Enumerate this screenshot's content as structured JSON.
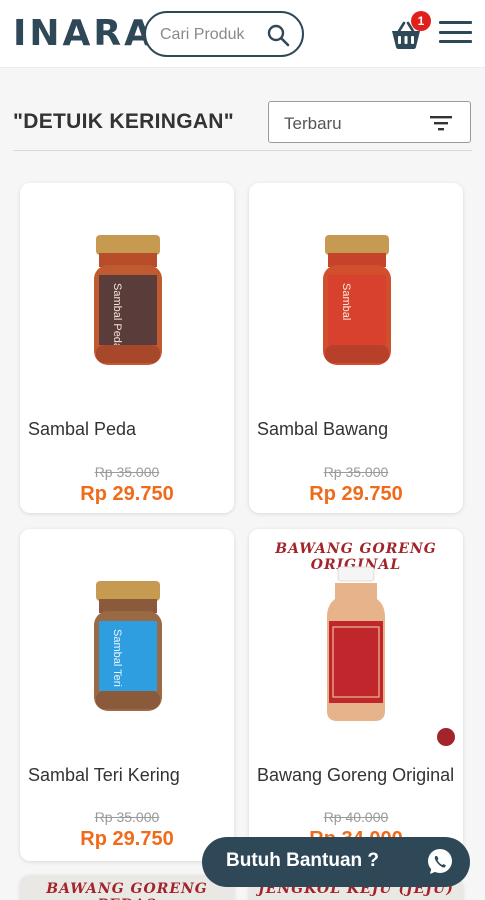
{
  "header": {
    "logo": "INARA",
    "search_placeholder": "Cari Produk",
    "cart_count": "1"
  },
  "listing": {
    "title": "\"DETUIK KERINGAN\"",
    "sort_value": "Terbaru"
  },
  "products": [
    {
      "name": "Sambal Peda",
      "old_price": "Rp 35.000",
      "price": "Rp 29.750",
      "jar_label": "Sambal Peda",
      "label_color": "#5a3d3a"
    },
    {
      "name": "Sambal Bawang",
      "old_price": "Rp 35.000",
      "price": "Rp 29.750",
      "jar_label": "Sambal",
      "label_color": "#d8412e"
    },
    {
      "name": "Sambal Teri Kering",
      "old_price": "Rp 35.000",
      "price": "Rp 29.750",
      "jar_label": "Sambal Teri",
      "label_color": "#2f9ee0"
    },
    {
      "name": "Bawang Goreng Original",
      "old_price": "Rp 40.000",
      "price": "Rp 34.000",
      "banner": "BAWANG GORENG ORIGINAL"
    },
    {
      "banner": "BAWANG GORENG PEDAS"
    },
    {
      "banner": "JENGKOL KEJU (JEJU)"
    }
  ],
  "help_button": {
    "label": "Butuh Bantuan ?"
  },
  "colors": {
    "brand": "#2f4858",
    "price": "#ef6a1a",
    "badge": "#e0201b"
  }
}
